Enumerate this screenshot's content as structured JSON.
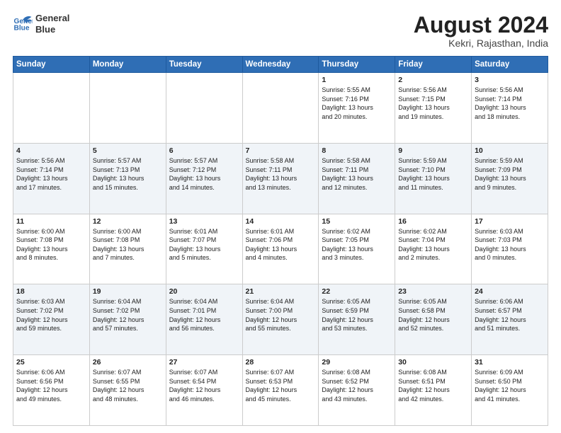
{
  "header": {
    "logo_line1": "General",
    "logo_line2": "Blue",
    "month_title": "August 2024",
    "location": "Kekri, Rajasthan, India"
  },
  "days_of_week": [
    "Sunday",
    "Monday",
    "Tuesday",
    "Wednesday",
    "Thursday",
    "Friday",
    "Saturday"
  ],
  "weeks": [
    [
      {
        "day": "",
        "text": ""
      },
      {
        "day": "",
        "text": ""
      },
      {
        "day": "",
        "text": ""
      },
      {
        "day": "",
        "text": ""
      },
      {
        "day": "1",
        "text": "Sunrise: 5:55 AM\nSunset: 7:16 PM\nDaylight: 13 hours\nand 20 minutes."
      },
      {
        "day": "2",
        "text": "Sunrise: 5:56 AM\nSunset: 7:15 PM\nDaylight: 13 hours\nand 19 minutes."
      },
      {
        "day": "3",
        "text": "Sunrise: 5:56 AM\nSunset: 7:14 PM\nDaylight: 13 hours\nand 18 minutes."
      }
    ],
    [
      {
        "day": "4",
        "text": "Sunrise: 5:56 AM\nSunset: 7:14 PM\nDaylight: 13 hours\nand 17 minutes."
      },
      {
        "day": "5",
        "text": "Sunrise: 5:57 AM\nSunset: 7:13 PM\nDaylight: 13 hours\nand 15 minutes."
      },
      {
        "day": "6",
        "text": "Sunrise: 5:57 AM\nSunset: 7:12 PM\nDaylight: 13 hours\nand 14 minutes."
      },
      {
        "day": "7",
        "text": "Sunrise: 5:58 AM\nSunset: 7:11 PM\nDaylight: 13 hours\nand 13 minutes."
      },
      {
        "day": "8",
        "text": "Sunrise: 5:58 AM\nSunset: 7:11 PM\nDaylight: 13 hours\nand 12 minutes."
      },
      {
        "day": "9",
        "text": "Sunrise: 5:59 AM\nSunset: 7:10 PM\nDaylight: 13 hours\nand 11 minutes."
      },
      {
        "day": "10",
        "text": "Sunrise: 5:59 AM\nSunset: 7:09 PM\nDaylight: 13 hours\nand 9 minutes."
      }
    ],
    [
      {
        "day": "11",
        "text": "Sunrise: 6:00 AM\nSunset: 7:08 PM\nDaylight: 13 hours\nand 8 minutes."
      },
      {
        "day": "12",
        "text": "Sunrise: 6:00 AM\nSunset: 7:08 PM\nDaylight: 13 hours\nand 7 minutes."
      },
      {
        "day": "13",
        "text": "Sunrise: 6:01 AM\nSunset: 7:07 PM\nDaylight: 13 hours\nand 5 minutes."
      },
      {
        "day": "14",
        "text": "Sunrise: 6:01 AM\nSunset: 7:06 PM\nDaylight: 13 hours\nand 4 minutes."
      },
      {
        "day": "15",
        "text": "Sunrise: 6:02 AM\nSunset: 7:05 PM\nDaylight: 13 hours\nand 3 minutes."
      },
      {
        "day": "16",
        "text": "Sunrise: 6:02 AM\nSunset: 7:04 PM\nDaylight: 13 hours\nand 2 minutes."
      },
      {
        "day": "17",
        "text": "Sunrise: 6:03 AM\nSunset: 7:03 PM\nDaylight: 13 hours\nand 0 minutes."
      }
    ],
    [
      {
        "day": "18",
        "text": "Sunrise: 6:03 AM\nSunset: 7:02 PM\nDaylight: 12 hours\nand 59 minutes."
      },
      {
        "day": "19",
        "text": "Sunrise: 6:04 AM\nSunset: 7:02 PM\nDaylight: 12 hours\nand 57 minutes."
      },
      {
        "day": "20",
        "text": "Sunrise: 6:04 AM\nSunset: 7:01 PM\nDaylight: 12 hours\nand 56 minutes."
      },
      {
        "day": "21",
        "text": "Sunrise: 6:04 AM\nSunset: 7:00 PM\nDaylight: 12 hours\nand 55 minutes."
      },
      {
        "day": "22",
        "text": "Sunrise: 6:05 AM\nSunset: 6:59 PM\nDaylight: 12 hours\nand 53 minutes."
      },
      {
        "day": "23",
        "text": "Sunrise: 6:05 AM\nSunset: 6:58 PM\nDaylight: 12 hours\nand 52 minutes."
      },
      {
        "day": "24",
        "text": "Sunrise: 6:06 AM\nSunset: 6:57 PM\nDaylight: 12 hours\nand 51 minutes."
      }
    ],
    [
      {
        "day": "25",
        "text": "Sunrise: 6:06 AM\nSunset: 6:56 PM\nDaylight: 12 hours\nand 49 minutes."
      },
      {
        "day": "26",
        "text": "Sunrise: 6:07 AM\nSunset: 6:55 PM\nDaylight: 12 hours\nand 48 minutes."
      },
      {
        "day": "27",
        "text": "Sunrise: 6:07 AM\nSunset: 6:54 PM\nDaylight: 12 hours\nand 46 minutes."
      },
      {
        "day": "28",
        "text": "Sunrise: 6:07 AM\nSunset: 6:53 PM\nDaylight: 12 hours\nand 45 minutes."
      },
      {
        "day": "29",
        "text": "Sunrise: 6:08 AM\nSunset: 6:52 PM\nDaylight: 12 hours\nand 43 minutes."
      },
      {
        "day": "30",
        "text": "Sunrise: 6:08 AM\nSunset: 6:51 PM\nDaylight: 12 hours\nand 42 minutes."
      },
      {
        "day": "31",
        "text": "Sunrise: 6:09 AM\nSunset: 6:50 PM\nDaylight: 12 hours\nand 41 minutes."
      }
    ]
  ]
}
